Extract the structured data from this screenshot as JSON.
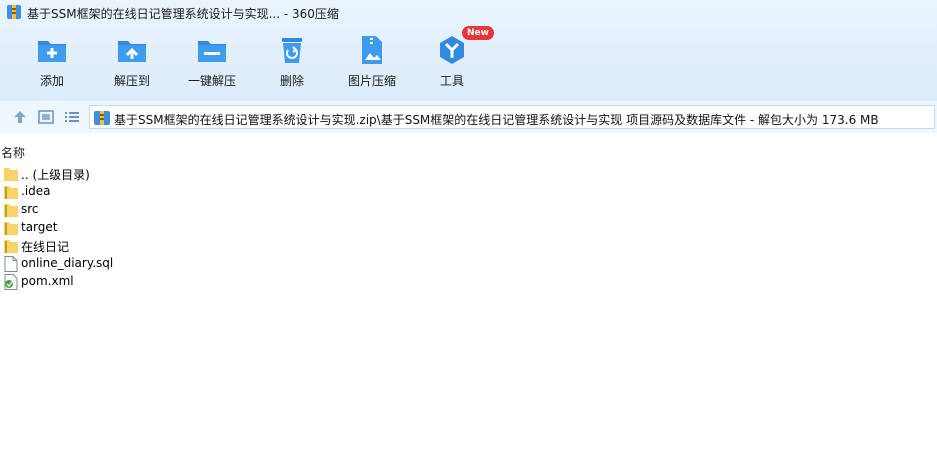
{
  "window": {
    "title": "基于SSM框架的在线日记管理系统设计与实现... - 360压缩"
  },
  "toolbar": {
    "items": [
      {
        "label": "添加",
        "icon": "add-folder-icon"
      },
      {
        "label": "解压到",
        "icon": "extract-to-icon"
      },
      {
        "label": "一键解压",
        "icon": "one-click-extract-icon"
      },
      {
        "label": "删除",
        "icon": "recycle-bin-icon"
      },
      {
        "label": "图片压缩",
        "icon": "image-compress-icon"
      },
      {
        "label": "工具",
        "icon": "tools-icon",
        "badge": "New"
      }
    ]
  },
  "nav": {
    "path": "基于SSM框架的在线日记管理系统设计与实现.zip\\基于SSM框架的在线日记管理系统设计与实现 项目源码及数据库文件 - 解包大小为 173.6 MB"
  },
  "list": {
    "header": "名称",
    "files": [
      {
        "name": ".. (上级目录)",
        "type": "folder"
      },
      {
        "name": ".idea",
        "type": "folder-zip"
      },
      {
        "name": "src",
        "type": "folder-zip"
      },
      {
        "name": "target",
        "type": "folder-zip"
      },
      {
        "name": "在线日记",
        "type": "folder-zip"
      },
      {
        "name": "online_diary.sql",
        "type": "file"
      },
      {
        "name": "pom.xml",
        "type": "xml"
      }
    ]
  },
  "colors": {
    "accent": "#2f8ae0",
    "badge": "#e8363b",
    "toolbar_bg": "#e2effb",
    "folder": "#f7d36a"
  }
}
